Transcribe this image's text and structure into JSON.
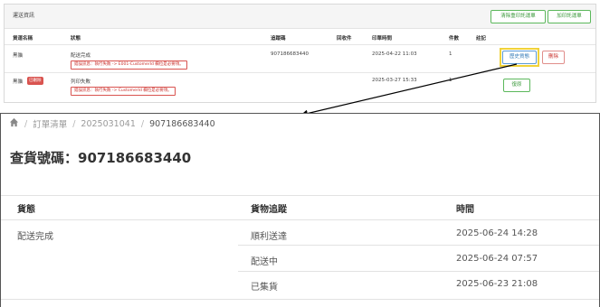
{
  "top": {
    "title": "運送資訊",
    "buttons": {
      "clear_print": "清除重印託運單",
      "add_print": "加印託運單"
    },
    "headers": [
      "貨運名稱",
      "狀態",
      "追蹤碼",
      "回收件",
      "印單時間",
      "件數",
      "註記"
    ],
    "rows": [
      {
        "carrier": "黑貓",
        "status": "配送完成",
        "error": "錯誤訊息：執行失敗 -> E001-CustomerId 欄位是必要項。",
        "tracking": "907186683440",
        "print_time": "2025-04-22 11:03",
        "count": "1",
        "history_label": "歷史貨態",
        "delete_label": "刪除"
      },
      {
        "carrier": "黑貓",
        "badge": "已刪除",
        "status": "列印失敗",
        "error": "錯誤訊息：執行失敗 -> CustomerId 欄位是必要項。",
        "tracking": "",
        "print_time": "2025-03-27 15:33",
        "count": "1",
        "restore_label": "復原"
      }
    ]
  },
  "breadcrumb": {
    "items": [
      "訂單清單",
      "2025031041",
      "907186683440"
    ]
  },
  "page_title": "查貨號碼：907186683440",
  "history": {
    "headers": [
      "貨態",
      "貨物追蹤",
      "時間"
    ],
    "rows": [
      {
        "status": "配送完成",
        "track": "順利送達",
        "time": "2025-06-24 14:28"
      },
      {
        "status": "",
        "track": "配送中",
        "time": "2025-06-24 07:57"
      },
      {
        "status": "",
        "track": "已集貨",
        "time": "2025-06-23 21:08"
      }
    ]
  },
  "colors": {
    "accent_green": "#5cb85c",
    "danger_red": "#d9534f",
    "highlight_yellow": "#f0d23a"
  },
  "icons": {
    "home": "home-icon"
  }
}
